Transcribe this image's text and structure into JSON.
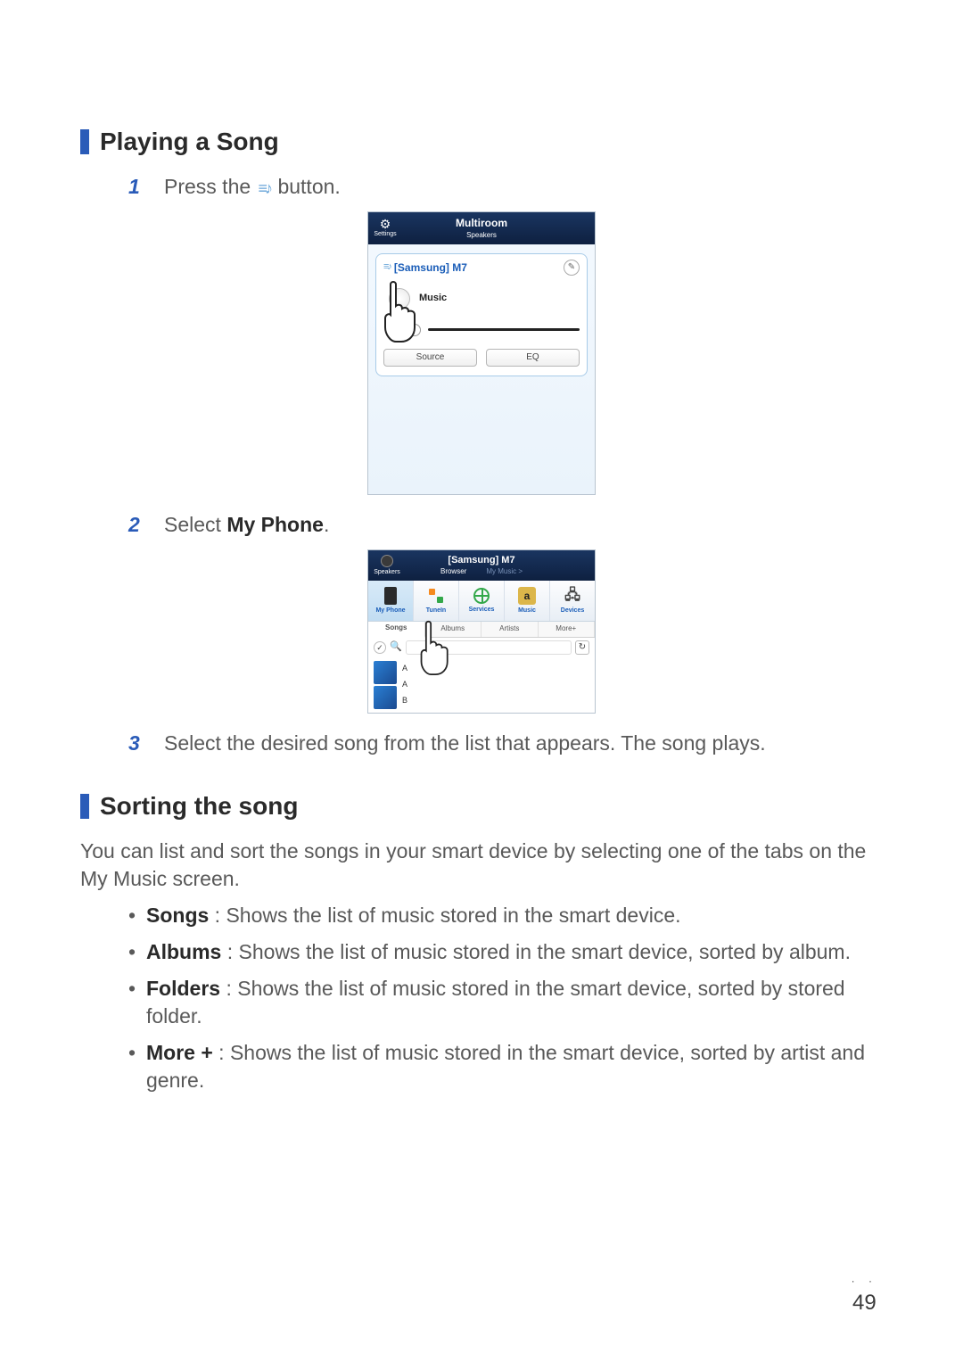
{
  "sections": {
    "playing": {
      "title": "Playing a Song"
    },
    "sorting": {
      "title": "Sorting the song",
      "intro": "You can list and sort the songs in your smart device by selecting one of the tabs on the My Music screen."
    }
  },
  "steps": {
    "s1": {
      "num": "1",
      "text_before": "Press the ",
      "text_after": " button."
    },
    "s2": {
      "num": "2",
      "text_before": "Select ",
      "bold": "My Phone",
      "text_after": "."
    },
    "s3": {
      "num": "3",
      "text": "Select the desired song from the list that appears. The song plays."
    }
  },
  "shot1": {
    "settings_label": "Settings",
    "title": "Multiroom",
    "subtitle": "Speakers",
    "speaker_name": "[Samsung] M7",
    "track": "Music",
    "btn_source": "Source",
    "btn_eq": "EQ"
  },
  "shot2": {
    "speakers_label": "Speakers",
    "title": "[Samsung] M7",
    "tab_browser": "Browser",
    "tab_mymusic": "My Music >",
    "icons": {
      "myphone": "My Phone",
      "tunein": "TuneIn",
      "services": "Services",
      "music": "Music",
      "devices": "Devices",
      "amz_letter": "a"
    },
    "tabs": {
      "songs": "Songs",
      "albums": "Albums",
      "artists": "Artists",
      "more": "More+"
    },
    "letters": {
      "a1": "A",
      "a2": "A",
      "b": "B"
    }
  },
  "bullets": {
    "songs": {
      "label": "Songs",
      "text": " : Shows the list of music stored in the smart device."
    },
    "albums": {
      "label": "Albums",
      "text": " : Shows the list of music stored in the smart device, sorted by album."
    },
    "folders": {
      "label": "Folders",
      "text": " : Shows the list of music stored in the smart device, sorted by stored folder."
    },
    "more": {
      "label": "More +",
      "text": " : Shows the list of music stored in the smart device, sorted by artist and genre."
    }
  },
  "page_number": "49"
}
